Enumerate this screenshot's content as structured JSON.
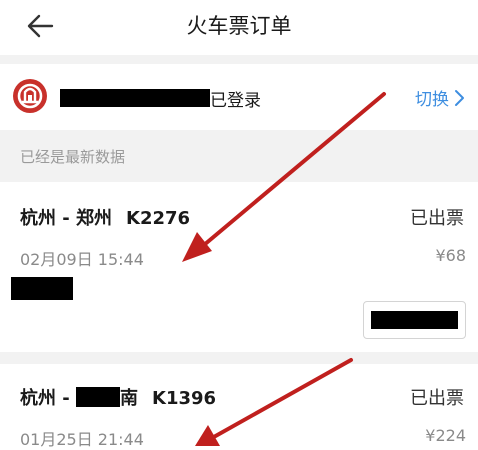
{
  "header": {
    "title": "火车票订单"
  },
  "account": {
    "status": "已登录",
    "switch_label": "切换"
  },
  "hint": "已经是最新数据",
  "orders": [
    {
      "route_prefix": "杭州 - 郑州",
      "train": "K2276",
      "status": "已出票",
      "time": "02月09日 15:44",
      "price": "¥68"
    },
    {
      "route_prefix": "杭州 - ",
      "route_suffix": "南",
      "train": "K1396",
      "status": "已出票",
      "time": "01月25日 21:44",
      "price": "¥224"
    }
  ],
  "colors": {
    "accent": "#3e8ee0",
    "logo": "#c8312b",
    "annotation": "#c0201e"
  }
}
